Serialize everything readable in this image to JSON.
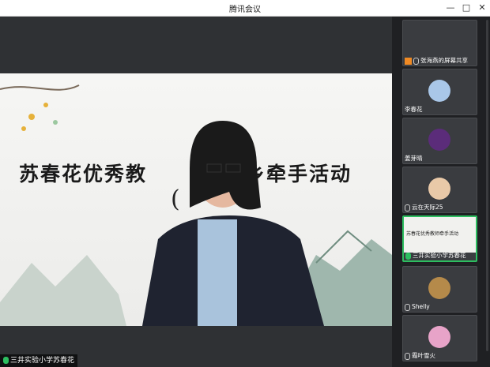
{
  "window": {
    "title": "腾讯会议",
    "controls": [
      "—",
      "□",
      "✕"
    ]
  },
  "main": {
    "slide_title": "苏春花优秀教",
    "slide_title_right": "乡牵手活动",
    "slide_subtitle": "(",
    "speaker_label": "三井实验小学苏春花"
  },
  "participants": [
    {
      "name": "张海燕的屏幕共享",
      "type": "share"
    },
    {
      "name": "李春花",
      "type": "avatar",
      "color": "#a9c7e8"
    },
    {
      "name": "姜芽晴",
      "type": "avatar",
      "color": "#5b2c7a"
    },
    {
      "name": "云在天际25",
      "type": "avatar",
      "color": "#e9c9a8"
    },
    {
      "name": "三井实验小学苏春花",
      "type": "video",
      "thumb_text": "苏春花优秀教师牵手活动"
    },
    {
      "name": "Shelly",
      "type": "avatar",
      "color": "#b58a4a"
    },
    {
      "name": "霜叶雪火",
      "type": "avatar",
      "color": "#e7a3c8"
    }
  ],
  "colors": {
    "active_border": "#2dbe60",
    "share_badge": "#f08a24"
  }
}
